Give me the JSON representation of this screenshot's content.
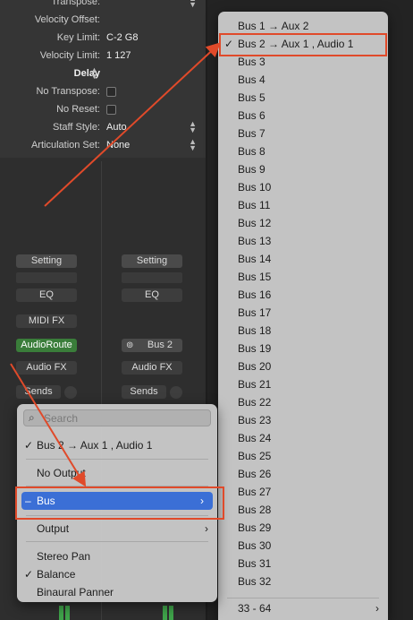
{
  "inspector": {
    "rows": [
      {
        "label": "Transpose:",
        "value": "",
        "type": "stepper"
      },
      {
        "label": "Velocity Offset:",
        "value": "",
        "type": "text"
      },
      {
        "label": "Key Limit:",
        "value": "C-2  G8",
        "type": "text"
      },
      {
        "label": "Velocity Limit:",
        "value": "1  127",
        "type": "text"
      },
      {
        "label": "Delay",
        "value": "",
        "type": "delay"
      },
      {
        "label": "No Transpose:",
        "value": "",
        "type": "checkbox"
      },
      {
        "label": "No Reset:",
        "value": "",
        "type": "checkbox"
      },
      {
        "label": "Staff Style:",
        "value": "Auto",
        "type": "stepper"
      },
      {
        "label": "Articulation Set:",
        "value": "None",
        "type": "stepper"
      }
    ]
  },
  "strip1": {
    "setting": "Setting",
    "eq": "EQ",
    "midi_fx": "MIDI FX",
    "output": "AudioRoute",
    "audio_fx": "Audio FX",
    "sends": "Sends"
  },
  "strip2": {
    "setting": "Setting",
    "eq": "EQ",
    "output": "Bus 2",
    "audio_fx": "Audio FX",
    "sends": "Sends"
  },
  "bus_menu": {
    "items": [
      "Bus 1 → Aux 2",
      "Bus 2 → Aux 1 , Audio 1",
      "Bus 3",
      "Bus 4",
      "Bus 5",
      "Bus 6",
      "Bus 7",
      "Bus 8",
      "Bus 9",
      "Bus 10",
      "Bus 11",
      "Bus 12",
      "Bus 13",
      "Bus 14",
      "Bus 15",
      "Bus 16",
      "Bus 17",
      "Bus 18",
      "Bus 19",
      "Bus 20",
      "Bus 21",
      "Bus 22",
      "Bus 23",
      "Bus 24",
      "Bus 25",
      "Bus 26",
      "Bus 27",
      "Bus 28",
      "Bus 29",
      "Bus 30",
      "Bus 31",
      "Bus 32"
    ],
    "checked_index": 1,
    "more": "33 - 64"
  },
  "route_menu": {
    "search_placeholder": "Search",
    "current": "Bus 2 → Aux 1 , Audio 1",
    "no_output": "No Output",
    "bus": "Bus",
    "output": "Output",
    "stereo_pan": "Stereo Pan",
    "balance": "Balance",
    "binaural": "Binaural Panner"
  },
  "colors": {
    "highlight": "#3b6fd6",
    "annotation": "#e04a2a",
    "route_green": "#3a7d3a"
  }
}
